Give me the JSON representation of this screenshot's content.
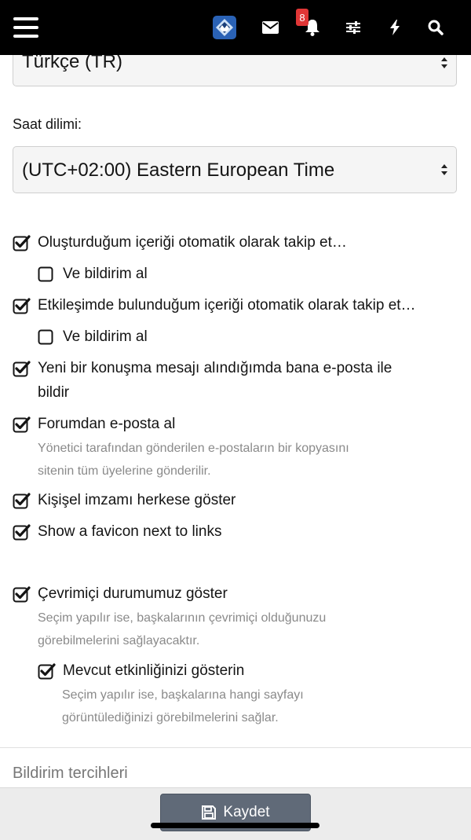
{
  "topbar": {
    "icons": [
      "menu-icon",
      "site-logo-icon",
      "envelope-icon",
      "bell-icon",
      "sliders-icon",
      "bolt-icon",
      "search-icon"
    ],
    "notification_count": "8"
  },
  "language_select": {
    "value": "Türkçe (TR)"
  },
  "timezone": {
    "label": "Saat dilimi:",
    "value": "(UTC+02:00) Eastern European Time"
  },
  "options": {
    "follow_created": {
      "label": "Oluşturduğum içeriği otomatik olarak takip et…",
      "checked": true
    },
    "follow_created_notify": {
      "label": "Ve bildirim al",
      "checked": false
    },
    "follow_interacted": {
      "label": "Etkileşimde bulunduğum içeriği otomatik olarak takip et…",
      "checked": true
    },
    "follow_interacted_notify": {
      "label": "Ve bildirim al",
      "checked": false
    },
    "email_on_conversation": {
      "line1": "Yeni bir konuşma mesajı alındığımda bana e-posta ile",
      "line2": "bildir",
      "checked": true
    },
    "forum_email": {
      "label": "Forumdan e-posta al",
      "hint1": "Yönetici tarafından gönderilen e-postaların bir kopyasını",
      "hint2": "sitenin tüm üyelerine gönderilir.",
      "checked": true
    },
    "show_signature": {
      "label": "Kişişel imzamı herkese göster",
      "checked": true
    },
    "show_favicon": {
      "label": "Show a favicon next to links",
      "checked": true
    },
    "show_online": {
      "label": "Çevrimiçi durumumuz göster",
      "hint1": "Seçim yapılır ise, başkalarının çevrimiçi olduğunuzu",
      "hint2": "görebilmelerini sağlayacaktır.",
      "checked": true
    },
    "show_activity": {
      "label": "Mevcut etkinliğinizi gösterin",
      "hint1": "Seçim yapılır ise, başkalarına hangi sayfayı",
      "hint2": "görüntülediğinizi görebilmelerini sağlar.",
      "checked": true
    }
  },
  "section": {
    "title": "Bildirim tercihleri"
  },
  "footer": {
    "save_label": "Kaydet",
    "save_icon": "floppy-disk-icon"
  },
  "colors": {
    "topbar": "#000000",
    "badge": "#e03636",
    "save_button": "#606a78",
    "hint_text": "#8a8a8a"
  }
}
